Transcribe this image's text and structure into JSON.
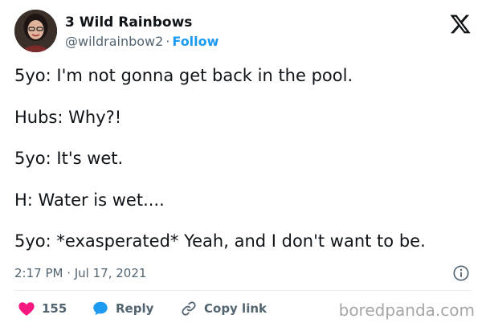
{
  "tweet": {
    "author_name": "3 Wild Rainbows",
    "handle": "@wildrainbow2",
    "separator": "·",
    "follow_label": "Follow",
    "lines": [
      "5yo: I'm not gonna get back in the pool.",
      "Hubs: Why?!",
      "5yo: It's wet.",
      "H: Water is wet....",
      "5yo: *exasperated* Yeah, and I don't want to be."
    ],
    "timestamp": "2:17 PM · Jul 17, 2021",
    "likes_count": "155",
    "reply_label": "Reply",
    "copy_link_label": "Copy link"
  },
  "icons": {
    "logo": "x-logo-icon",
    "info": "info-icon",
    "like": "heart-icon",
    "reply": "speech-bubble-icon",
    "copy": "link-icon"
  },
  "colors": {
    "accent": "#1d9bf0",
    "like": "#f91880",
    "text": "#0f1419",
    "muted": "#536471",
    "watermark": "#a6a6a6"
  },
  "watermark": "boredpanda.com"
}
